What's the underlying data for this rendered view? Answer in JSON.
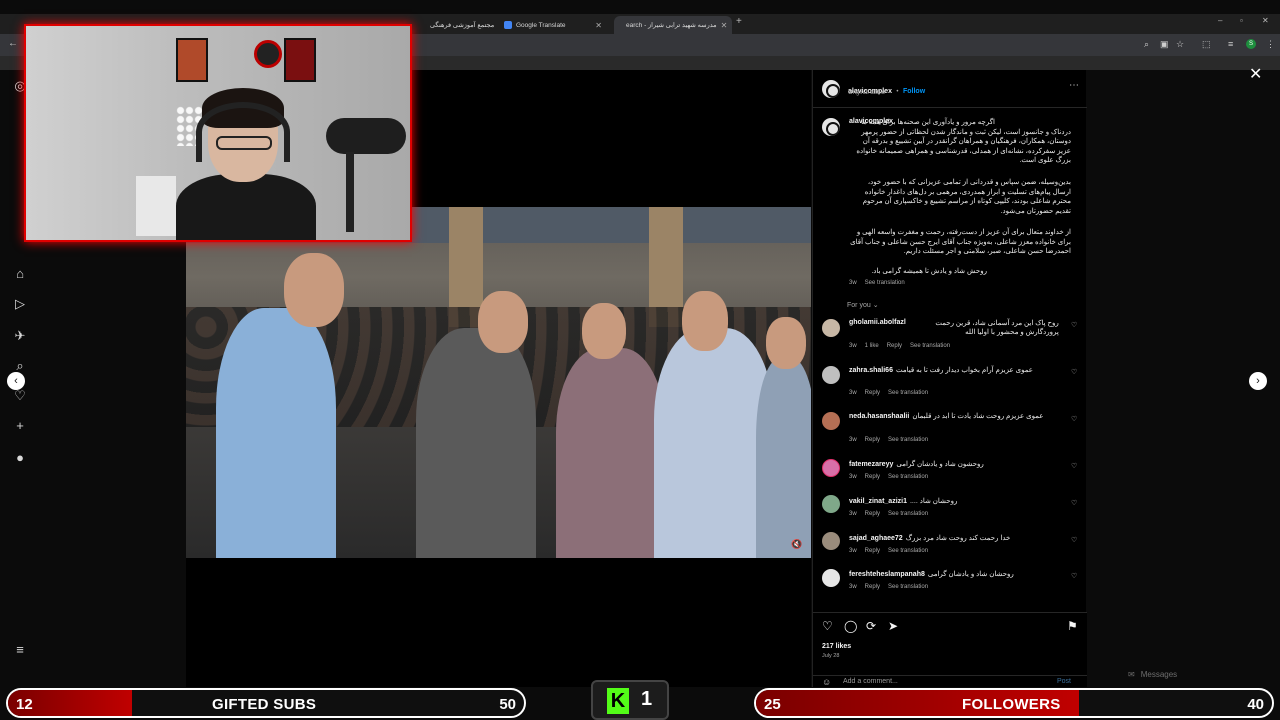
{
  "browser": {
    "tabs": [
      {
        "label": "مجتمع آموزشی فرهنگی",
        "active": false
      },
      {
        "label": "Google Translate",
        "active": false
      },
      {
        "label": "earch - مدرسه شهید ترابی شیراز",
        "active": true
      }
    ]
  },
  "post": {
    "username": "alavicomplex",
    "follow_label": "Follow",
    "separator": "•",
    "audio": "Original audio",
    "caption": [
      "اگرچه مرور و یادآوری این صحنه‌ها برای همه ما دردناک و جانسوز است، لیکن ثبت و ماندگار شدن لحظاتی از حضور پرمهر دوستان، همکاران، فرهنگیان و همراهان گرانقدر در آیین تشییع و بدرقه آن عزیز سفرکرده، نشانه‌ای از همدلی، قدرشناسی و همراهی صمیمانه خانواده بزرگ علوی است.",
      "بدین‌وسیله، ضمن سپاس و قدردانی از تمامی عزیزانی که با حضور خود، ارسال پیام‌های تسلیت و ابراز همدردی، مرهمی بر دل‌های داغدار خانواده محترم شاعلی بودند، کلیپی کوتاه از مراسم تشییع و خاکسپاری آن مرحوم تقدیم حضورتان می‌شود.",
      "از خداوند متعال برای آن عزیز از دست‌رفته، رحمت و مغفرت واسعه الهی و برای خانواده معزز شاعلی، به‌ویژه جناب آقای ایرج حسن شاعلی و جناب آقای احمدرضا حسن شاعلی، صبر، سلامتی و اجر مسئلت داریم.",
      "روحش شاد و یادش تا همیشه گرامی باد."
    ],
    "caption_time": "3w",
    "see_translation": "See translation",
    "for_you": "For you",
    "likes": "217 likes",
    "date": "July 28",
    "add_comment_placeholder": "Add a comment...",
    "post_label": "Post"
  },
  "comments": [
    {
      "user": "gholamii.abolfazl",
      "text": "روح پاک این مرد آسمانی شاد، قرین رحمت پروردگارش و محشور با اولیا الله",
      "time": "3w",
      "likes": "1 like",
      "reply": "Reply",
      "translate": "See translation"
    },
    {
      "user": "zahra.shali66",
      "text": "عموی عزیزم آرام بخواب دیدار رفت تا به قیامت",
      "time": "3w",
      "likes": "",
      "reply": "Reply",
      "translate": "See translation"
    },
    {
      "user": "neda.hasanshaalii",
      "text": "عموی عزیزم روحت شاد یادت تا ابد در قلبمان",
      "time": "3w",
      "likes": "",
      "reply": "Reply",
      "translate": "See translation"
    },
    {
      "user": "fatemezareyy",
      "text": "روحشون شاد و یادشان گرامی",
      "time": "3w",
      "likes": "",
      "reply": "Reply",
      "translate": "See translation"
    },
    {
      "user": "vakil_zinat_azizi1",
      "text": "روحشان شاد ....",
      "time": "3w",
      "likes": "",
      "reply": "Reply",
      "translate": "See translation"
    },
    {
      "user": "sajad_aghaee72",
      "text": "خدا رحمت کند روحت شاد مرد بزرگ",
      "time": "3w",
      "likes": "",
      "reply": "Reply",
      "translate": "See translation"
    },
    {
      "user": "fereshteheslampanah8",
      "text": "روحشان شاد و یادشان گرامی",
      "time": "3w",
      "likes": "",
      "reply": "Reply",
      "translate": "See translation"
    }
  ],
  "sidebar": {
    "messages_label": "Messages"
  },
  "overlay": {
    "gifted": {
      "current": "12",
      "label": "GIFTED SUBS",
      "goal": "50",
      "progress": 0.24
    },
    "kick_count": "1",
    "followers": {
      "current": "25",
      "label": "FOLLOWERS",
      "goal": "40",
      "progress": 0.625
    }
  },
  "colors": {
    "accent_red": "#c40000",
    "instagram_blue": "#0095f6",
    "kick_green": "#53fc18"
  }
}
